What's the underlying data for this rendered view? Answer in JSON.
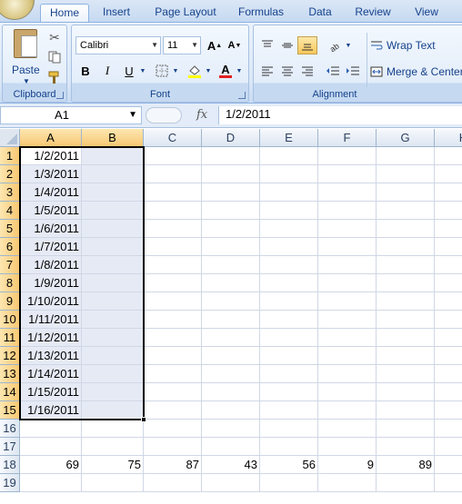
{
  "tabs": [
    {
      "label": "Home",
      "active": true
    },
    {
      "label": "Insert",
      "active": false
    },
    {
      "label": "Page Layout",
      "active": false
    },
    {
      "label": "Formulas",
      "active": false
    },
    {
      "label": "Data",
      "active": false
    },
    {
      "label": "Review",
      "active": false
    },
    {
      "label": "View",
      "active": false
    }
  ],
  "ribbon": {
    "clipboard": {
      "label": "Clipboard",
      "paste_label": "Paste"
    },
    "font": {
      "label": "Font",
      "font_name": "Calibri",
      "font_size": "11",
      "bold": "B",
      "italic": "I",
      "underline": "U",
      "grow": "A",
      "shrink": "A",
      "font_color_glyph": "A"
    },
    "alignment": {
      "label": "Alignment",
      "wrap_text": "Wrap Text",
      "merge_center": "Merge & Center"
    }
  },
  "formula_bar": {
    "name_box": "A1",
    "fx": "fx",
    "formula": "1/2/2011"
  },
  "columns": [
    "A",
    "B",
    "C",
    "D",
    "E",
    "F",
    "G",
    "H"
  ],
  "selected_columns": [
    "A",
    "B"
  ],
  "rows": [
    "1",
    "2",
    "3",
    "4",
    "5",
    "6",
    "7",
    "8",
    "9",
    "10",
    "11",
    "12",
    "13",
    "14",
    "15",
    "16",
    "17",
    "18",
    "19"
  ],
  "selected_rows": [
    "1",
    "2",
    "3",
    "4",
    "5",
    "6",
    "7",
    "8",
    "9",
    "10",
    "11",
    "12",
    "13",
    "14",
    "15"
  ],
  "column_a_values": [
    "1/2/2011",
    "1/3/2011",
    "1/4/2011",
    "1/5/2011",
    "1/6/2011",
    "1/7/2011",
    "1/8/2011",
    "1/9/2011",
    "1/10/2011",
    "1/11/2011",
    "1/12/2011",
    "1/13/2011",
    "1/14/2011",
    "1/15/2011",
    "1/16/2011"
  ],
  "row_18_values": [
    "69",
    "75",
    "87",
    "43",
    "56",
    "9",
    "89"
  ],
  "colors": {
    "selection_fill": "#e6eaf5",
    "header_selected": "#f7c873",
    "ribbon_text": "#15428b"
  }
}
